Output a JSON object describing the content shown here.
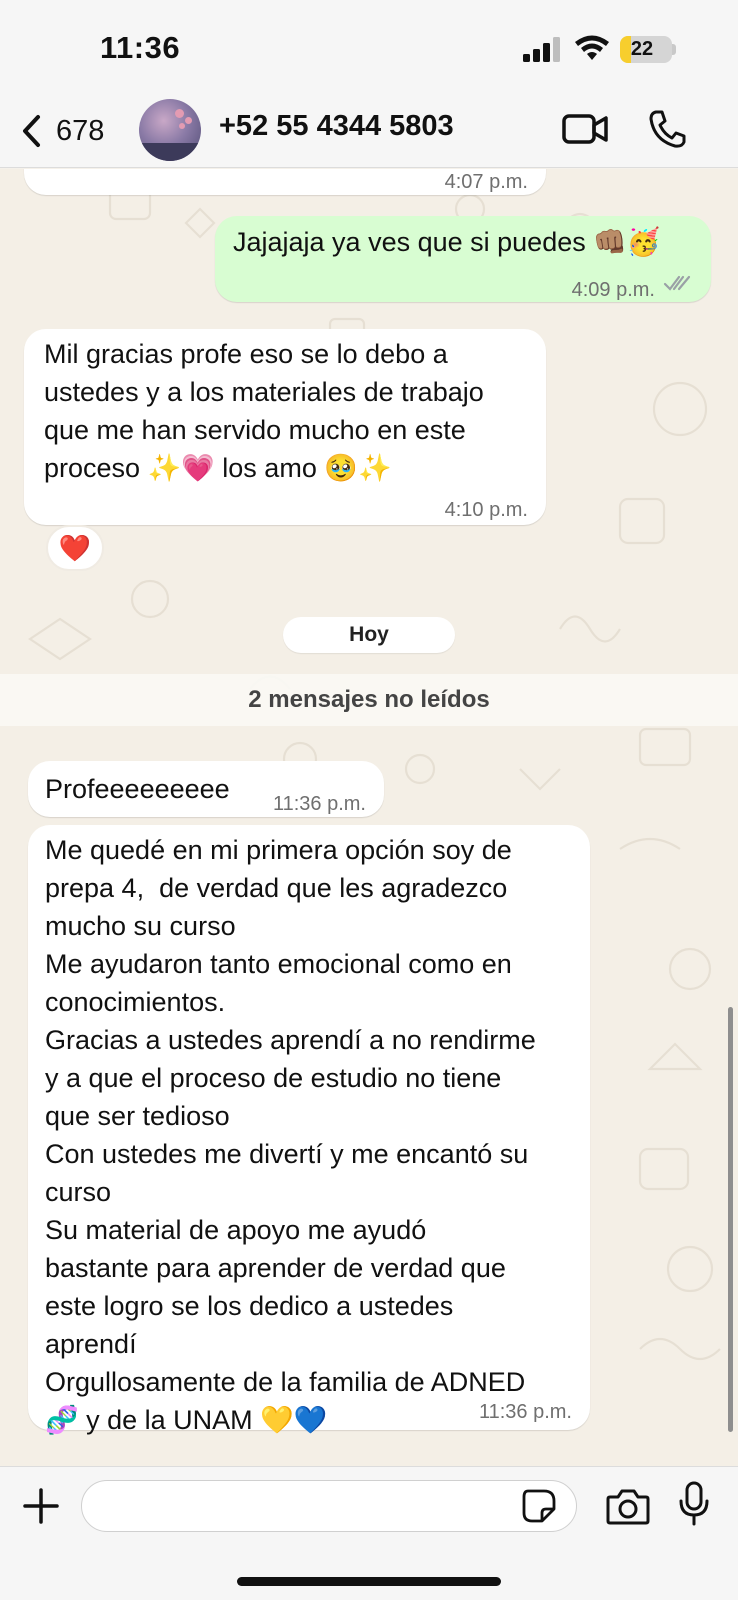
{
  "status_bar": {
    "time": "11:36",
    "battery_level": "22",
    "battery_fraction": 0.22,
    "icons": [
      "signal-icon",
      "wifi-icon",
      "battery-icon"
    ]
  },
  "header": {
    "back_count": "678",
    "contact_name": "+52 55 4344 5803",
    "icons": [
      "chevron-left-icon",
      "video-call-icon",
      "phone-icon"
    ]
  },
  "colors": {
    "outgoing_bubble": "#d8fdd2",
    "incoming_bubble": "#ffffff",
    "wallpaper": "#f4efe6",
    "read_ticks": "#9aa0a6",
    "battery_fill": "#f7ce2d"
  },
  "messages": [
    {
      "direction": "in",
      "text": "",
      "time": "4:07 p.m."
    },
    {
      "direction": "out",
      "text": "Jajajaja ya ves que si puedes 👊🏽🥳",
      "time": "4:09 p.m.",
      "status": "read"
    },
    {
      "direction": "in",
      "text": "Mil gracias profe eso se lo debo a\nustedes y a los materiales de trabajo\nque me han servido mucho en este\nproceso ✨💗 los amo 🥹✨",
      "time": "4:10 p.m.",
      "reaction": "❤️"
    },
    {
      "direction": "in",
      "text": "Profeeeeeeeee",
      "time": "11:36 p.m."
    },
    {
      "direction": "in",
      "text": "Me quedé en mi primera opción soy de\nprepa 4,  de verdad que les agradezco\nmucho su curso\nMe ayudaron tanto emocional como en\nconocimientos.\nGracias a ustedes aprendí a no rendirme\ny a que el proceso de estudio no tiene\nque ser tedioso\nCon ustedes me divertí y me encantó su\ncurso\nSu material de apoyo me ayudó\nbastante para aprender de verdad que\neste logro se los dedico a ustedes\naprendí\nOrgullosamente de la familia de ADNED\n🧬 y de la UNAM 💛💙",
      "time": "11:36 p.m."
    }
  ],
  "date_divider": "Hoy",
  "unread_banner": "2 mensajes no leídos",
  "input": {
    "value": "",
    "placeholder": "",
    "icons": [
      "plus-icon",
      "sticker-icon",
      "camera-icon",
      "microphone-icon"
    ]
  }
}
